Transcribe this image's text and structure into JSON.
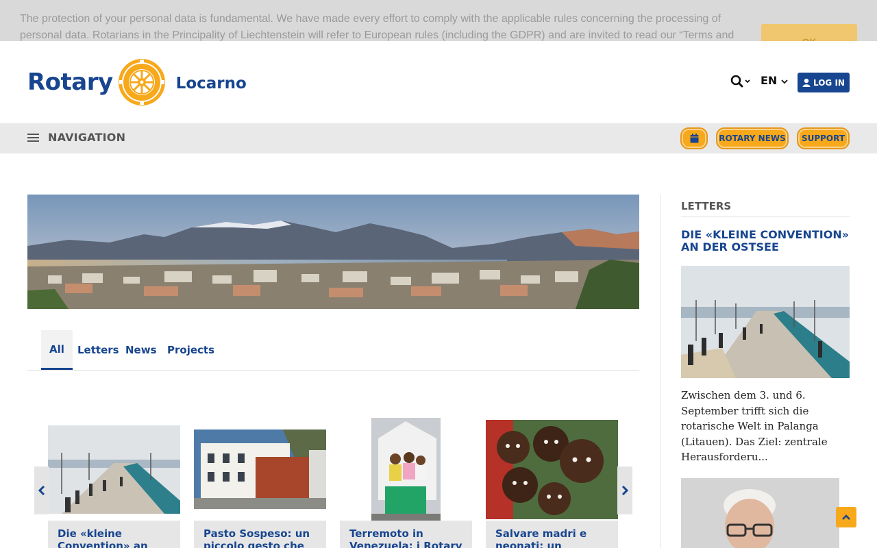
{
  "cookie": {
    "text": "The protection of your personal data is fundamental. We have made every effort to comply with the applicable rules concerning the processing of personal data. Rotarians in the Principality of Liechtenstein will refer to European rules (including the GDPR) and are invited to read our “Terms and",
    "ok_label": "OK"
  },
  "header": {
    "logo_word": "Rotary",
    "club_name": "Locarno",
    "language": "EN",
    "login_label": "LOG IN"
  },
  "nav": {
    "label": "NAVIGATION",
    "pills": [
      "ROTARY NEWS",
      "SUPPORT"
    ]
  },
  "tabs": [
    {
      "label": "All",
      "active": true
    },
    {
      "label": "Letters",
      "active": false
    },
    {
      "label": "News",
      "active": false
    },
    {
      "label": "Projects",
      "active": false
    }
  ],
  "cards": [
    {
      "title": "Die «kleine Convention» an der Ostsee"
    },
    {
      "title": "Pasto Sospeso: un piccolo gesto che"
    },
    {
      "title": "Terremoto in Venezuela: i Rotary Club ticinesi"
    },
    {
      "title": "Salvare madri e neonati: un progetto concreto del"
    }
  ],
  "sidebar": {
    "heading": "LETTERS",
    "article_title": "DIE «KLEINE CONVENTION» AN DER OSTSEE",
    "article_excerpt": "Zwischen dem 3. und 6. September trifft sich die rotarische Welt in Palanga (Litauen). Das Ziel: zentrale Herausforderu..."
  },
  "colors": {
    "rotary_blue": "#17458f",
    "rotary_gold": "#f7a81b",
    "nav_bg": "#e9e9e9"
  },
  "icons": [
    "search-icon",
    "chevron-down-icon",
    "user-icon",
    "hamburger-icon",
    "calendar-icon",
    "chevron-left-icon",
    "chevron-right-icon",
    "chevron-up-icon"
  ]
}
